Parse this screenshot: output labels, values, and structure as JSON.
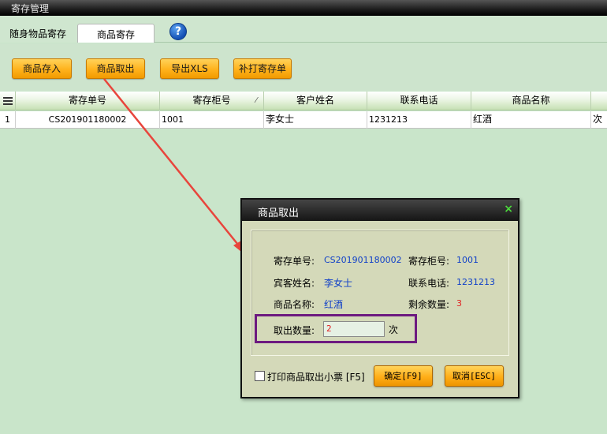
{
  "window": {
    "title": "寄存管理"
  },
  "tabs": [
    {
      "label": "随身物品寄存"
    },
    {
      "label": "商品寄存"
    }
  ],
  "help": {
    "glyph": "?"
  },
  "toolbar": {
    "buttons": [
      {
        "label": "商品存入"
      },
      {
        "label": "商品取出"
      },
      {
        "label": "导出XLS"
      },
      {
        "label": "补打寄存单"
      }
    ]
  },
  "grid": {
    "columns": [
      "寄存单号",
      "寄存柜号",
      "客户姓名",
      "联系电话",
      "商品名称"
    ],
    "sort_glyph": "⁄",
    "rows": [
      {
        "index": "1",
        "order_no": "CS201901180002",
        "cabinet": "1001",
        "customer": "李女士",
        "phone": "1231213",
        "product": "红酒",
        "unit": "次"
      }
    ]
  },
  "dialog": {
    "title": "商品取出",
    "close_glyph": "×",
    "fields": {
      "order_no_label": "寄存单号:",
      "order_no": "CS201901180002",
      "cabinet_label": "寄存柜号:",
      "cabinet": "1001",
      "guest_label": "宾客姓名:",
      "guest": "李女士",
      "phone_label": "联系电话:",
      "phone": "1231213",
      "product_label": "商品名称:",
      "product": "红酒",
      "remaining_label": "剩余数量:",
      "remaining": "3"
    },
    "quantity": {
      "label": "取出数量:",
      "value": "2",
      "unit": "次"
    },
    "print_option": {
      "label": "打印商品取出小票 [F5]",
      "checked": false
    },
    "ok_label": "确定[F9]",
    "cancel_label": "取消[ESC]"
  },
  "colors": {
    "background": "#c9e5ca",
    "button": "#ffb21c",
    "value_text": "#1040c8",
    "highlight_box": "#6d1a80",
    "arrow": "#e8453c"
  }
}
